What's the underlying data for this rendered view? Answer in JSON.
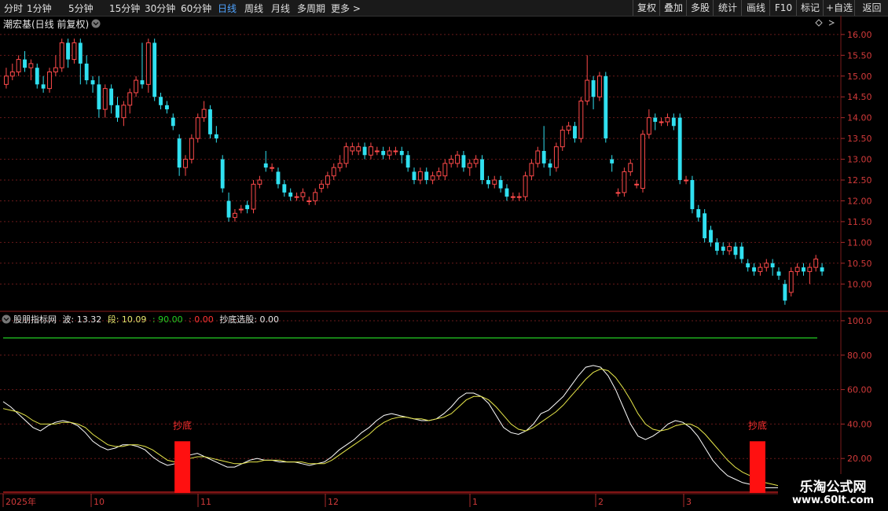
{
  "toolbar": {
    "periods": [
      "分时",
      "1分钟",
      "5分钟",
      "15分钟",
      "30分钟",
      "60分钟",
      "日线",
      "周线",
      "月线",
      "多周期",
      "更多"
    ],
    "active_period": "日线",
    "more_chevron": ">",
    "right_buttons": [
      "复权",
      "叠加",
      "多股",
      "统计",
      "画线",
      "F10",
      "标记",
      "+自选",
      "返回"
    ]
  },
  "main_panel": {
    "title": "潮宏基(日线 前复权)",
    "y_ticks": [
      "16.00",
      "15.50",
      "15.00",
      "14.50",
      "14.00",
      "13.50",
      "13.00",
      "12.50",
      "12.00",
      "11.50",
      "11.00",
      "10.50",
      "10.00"
    ]
  },
  "indicator_panel": {
    "name": "股朋指标网",
    "legend": [
      {
        "label": "波: 13.32",
        "color": "#e6e6e6"
      },
      {
        "label": "段: 10.09",
        "color": "#e6e66e"
      },
      {
        "label": ": 90.00",
        "color": "#22cc22"
      },
      {
        "label": ": 0.00",
        "color": "#ff3333"
      },
      {
        "label": "抄底选股: 0.00",
        "color": "#e6e6e6"
      }
    ],
    "y_ticks": [
      "100.0",
      "80.00",
      "60.00",
      "40.00",
      "20.00"
    ],
    "signal_label": "抄底"
  },
  "time_axis": [
    "2025年",
    "10",
    "11",
    "12",
    "1",
    "2",
    "3"
  ],
  "watermark": {
    "title": "乐淘公式网",
    "url": "www.60lt.com"
  },
  "colors": {
    "up": "#ff4a4a",
    "down": "#30e0f0",
    "wave": "#ffffff",
    "segment": "#e8e84a",
    "level_line": "#22cc22",
    "grid": "#6a1a1a",
    "signal": "#ff1010"
  },
  "chart_data": [
    {
      "type": "candlestick",
      "title": "潮宏基(日线 前复权)",
      "ylim": [
        9.4,
        16.3
      ],
      "candles": [
        [
          14.8,
          15.0,
          15.2,
          14.7
        ],
        [
          15.0,
          15.1,
          15.3,
          14.9
        ],
        [
          15.1,
          15.4,
          15.5,
          15.0
        ],
        [
          15.4,
          15.2,
          15.6,
          15.1
        ],
        [
          15.2,
          15.3,
          15.4,
          14.9
        ],
        [
          15.2,
          14.8,
          15.3,
          14.7
        ],
        [
          14.8,
          14.7,
          15.0,
          14.6
        ],
        [
          14.7,
          15.1,
          15.2,
          14.6
        ],
        [
          15.1,
          15.2,
          15.5,
          15.0
        ],
        [
          15.2,
          15.8,
          15.9,
          15.1
        ],
        [
          15.8,
          15.4,
          15.9,
          15.2
        ],
        [
          15.4,
          15.8,
          15.9,
          15.3
        ],
        [
          15.8,
          15.3,
          15.9,
          14.8
        ],
        [
          15.3,
          14.9,
          15.5,
          14.8
        ],
        [
          14.9,
          14.8,
          15.0,
          14.6
        ],
        [
          14.8,
          14.2,
          15.0,
          14.0
        ],
        [
          14.2,
          14.7,
          14.8,
          14.0
        ],
        [
          14.7,
          14.3,
          14.8,
          14.1
        ],
        [
          14.3,
          14.0,
          14.5,
          13.9
        ],
        [
          14.0,
          14.3,
          14.4,
          13.8
        ],
        [
          14.3,
          14.6,
          14.7,
          14.1
        ],
        [
          14.6,
          14.9,
          15.0,
          14.5
        ],
        [
          14.9,
          14.8,
          15.8,
          14.7
        ],
        [
          14.8,
          15.8,
          15.9,
          14.6
        ],
        [
          15.8,
          14.5,
          15.9,
          14.4
        ],
        [
          14.5,
          14.3,
          14.6,
          14.2
        ],
        [
          14.3,
          14.2,
          14.4,
          14.1
        ],
        [
          14.0,
          13.8,
          14.1,
          13.7
        ],
        [
          13.5,
          12.8,
          13.6,
          12.6
        ],
        [
          12.8,
          13.0,
          13.1,
          12.6
        ],
        [
          13.0,
          13.5,
          13.6,
          12.9
        ],
        [
          13.5,
          14.0,
          14.1,
          13.4
        ],
        [
          14.0,
          14.2,
          14.4,
          13.9
        ],
        [
          14.2,
          13.6,
          14.3,
          13.5
        ],
        [
          13.6,
          13.5,
          13.8,
          13.4
        ],
        [
          13.0,
          12.3,
          13.1,
          12.2
        ],
        [
          12.0,
          11.6,
          12.2,
          11.5
        ],
        [
          11.6,
          11.7,
          11.8,
          11.5
        ],
        [
          11.8,
          11.8,
          11.9,
          11.7
        ],
        [
          11.9,
          11.8,
          12.0,
          11.7
        ],
        [
          11.8,
          12.4,
          12.5,
          11.7
        ],
        [
          12.4,
          12.5,
          12.6,
          12.3
        ],
        [
          12.9,
          12.8,
          13.2,
          12.7
        ],
        [
          12.8,
          12.8,
          12.9,
          12.7
        ],
        [
          12.7,
          12.4,
          12.8,
          12.3
        ],
        [
          12.4,
          12.2,
          12.5,
          12.1
        ],
        [
          12.2,
          12.1,
          12.3,
          12.0
        ],
        [
          12.1,
          12.1,
          12.2,
          12.0
        ],
        [
          12.1,
          12.2,
          12.3,
          12.0
        ],
        [
          12.0,
          12.0,
          12.1,
          11.9
        ],
        [
          12.0,
          12.2,
          12.3,
          11.9
        ],
        [
          12.3,
          12.4,
          12.5,
          12.2
        ],
        [
          12.4,
          12.6,
          12.7,
          12.3
        ],
        [
          12.6,
          12.8,
          12.9,
          12.5
        ],
        [
          12.8,
          12.9,
          13.1,
          12.7
        ],
        [
          12.9,
          13.3,
          13.4,
          12.8
        ],
        [
          13.2,
          13.3,
          13.4,
          13.1
        ],
        [
          13.2,
          13.3,
          13.4,
          13.1
        ],
        [
          13.3,
          13.1,
          13.4,
          13.0
        ],
        [
          13.1,
          13.3,
          13.4,
          13.0
        ],
        [
          13.2,
          13.2,
          13.3,
          13.1
        ],
        [
          13.2,
          13.1,
          13.3,
          13.0
        ],
        [
          13.1,
          13.2,
          13.3,
          13.0
        ],
        [
          13.2,
          13.2,
          13.3,
          13.1
        ],
        [
          13.2,
          13.1,
          13.3,
          12.9
        ],
        [
          13.1,
          12.8,
          13.2,
          12.7
        ],
        [
          12.7,
          12.5,
          12.8,
          12.4
        ],
        [
          12.5,
          12.7,
          12.8,
          12.4
        ],
        [
          12.7,
          12.5,
          12.8,
          12.4
        ],
        [
          12.5,
          12.6,
          12.7,
          12.4
        ],
        [
          12.6,
          12.7,
          12.8,
          12.5
        ],
        [
          12.6,
          12.9,
          13.0,
          12.5
        ],
        [
          12.9,
          13.0,
          13.1,
          12.8
        ],
        [
          12.9,
          13.1,
          13.2,
          12.8
        ],
        [
          13.1,
          12.8,
          13.2,
          12.7
        ],
        [
          12.8,
          12.9,
          13.0,
          12.6
        ],
        [
          12.9,
          13.0,
          13.1,
          12.8
        ],
        [
          13.0,
          12.5,
          13.1,
          12.4
        ],
        [
          12.5,
          12.4,
          12.6,
          12.3
        ],
        [
          12.4,
          12.5,
          12.6,
          12.3
        ],
        [
          12.5,
          12.3,
          12.6,
          12.2
        ],
        [
          12.3,
          12.1,
          12.4,
          12.0
        ],
        [
          12.1,
          12.1,
          12.2,
          12.0
        ],
        [
          12.1,
          12.1,
          12.2,
          12.0
        ],
        [
          12.1,
          12.6,
          12.7,
          12.0
        ],
        [
          12.6,
          12.9,
          13.0,
          12.5
        ],
        [
          12.9,
          13.2,
          13.3,
          12.8
        ],
        [
          13.2,
          12.9,
          13.8,
          12.8
        ],
        [
          12.9,
          12.8,
          13.0,
          12.6
        ],
        [
          12.8,
          13.3,
          13.4,
          12.7
        ],
        [
          13.3,
          13.7,
          13.8,
          13.2
        ],
        [
          13.7,
          13.8,
          13.9,
          13.6
        ],
        [
          13.8,
          13.5,
          13.9,
          13.4
        ],
        [
          13.5,
          14.4,
          14.5,
          13.4
        ],
        [
          14.4,
          14.9,
          15.5,
          14.3
        ],
        [
          14.9,
          14.5,
          15.0,
          14.2
        ],
        [
          14.5,
          15.0,
          15.1,
          14.4
        ],
        [
          15.0,
          13.5,
          15.1,
          13.4
        ],
        [
          13.0,
          12.9,
          13.1,
          12.7
        ],
        [
          12.2,
          12.2,
          12.3,
          12.1
        ],
        [
          12.2,
          12.7,
          12.8,
          12.1
        ],
        [
          12.7,
          12.9,
          13.0,
          12.6
        ],
        [
          12.4,
          12.4,
          12.5,
          12.3
        ],
        [
          12.3,
          13.6,
          13.7,
          12.2
        ],
        [
          13.6,
          14.0,
          14.2,
          13.5
        ],
        [
          14.0,
          13.9,
          14.1,
          13.7
        ],
        [
          13.9,
          13.9,
          14.0,
          13.8
        ],
        [
          13.9,
          14.0,
          14.1,
          13.8
        ],
        [
          14.0,
          13.8,
          14.1,
          13.7
        ],
        [
          14.0,
          12.5,
          14.1,
          12.4
        ],
        [
          12.5,
          12.5,
          12.6,
          12.4
        ],
        [
          12.5,
          11.8,
          12.6,
          11.7
        ],
        [
          11.8,
          11.6,
          11.9,
          11.5
        ],
        [
          11.7,
          11.1,
          11.8,
          11.0
        ],
        [
          11.3,
          11.0,
          11.4,
          10.9
        ],
        [
          11.0,
          10.8,
          11.1,
          10.7
        ],
        [
          10.9,
          10.8,
          11.0,
          10.7
        ],
        [
          10.8,
          10.9,
          11.0,
          10.7
        ],
        [
          10.9,
          10.7,
          11.0,
          10.6
        ],
        [
          10.9,
          10.6,
          11.0,
          10.5
        ],
        [
          10.5,
          10.4,
          10.6,
          10.3
        ],
        [
          10.4,
          10.3,
          10.5,
          10.2
        ],
        [
          10.3,
          10.4,
          10.5,
          10.2
        ],
        [
          10.4,
          10.5,
          10.6,
          10.3
        ],
        [
          10.5,
          10.4,
          10.6,
          10.2
        ],
        [
          10.3,
          10.2,
          10.4,
          10.1
        ],
        [
          10.0,
          9.6,
          10.1,
          9.5
        ],
        [
          9.8,
          10.3,
          10.4,
          9.7
        ],
        [
          10.3,
          10.4,
          10.5,
          10.2
        ],
        [
          10.4,
          10.3,
          10.5,
          10.2
        ],
        [
          10.3,
          10.4,
          10.5,
          10.0
        ],
        [
          10.4,
          10.6,
          10.7,
          10.3
        ],
        [
          10.4,
          10.3,
          10.5,
          10.2
        ]
      ]
    },
    {
      "type": "line",
      "title": "股朋指标网",
      "ylim": [
        0,
        105
      ],
      "level": 90,
      "series": [
        {
          "name": "波",
          "values": [
            53,
            50,
            46,
            42,
            38,
            36,
            39,
            41,
            42,
            41,
            39,
            35,
            30,
            27,
            25,
            26,
            28,
            28,
            27,
            25,
            21,
            18,
            16,
            17,
            19,
            22,
            23,
            21,
            19,
            17,
            15,
            15,
            17,
            19,
            20,
            19,
            19,
            18,
            18,
            18,
            17,
            16,
            17,
            18,
            21,
            25,
            28,
            31,
            35,
            38,
            42,
            45,
            46,
            45,
            44,
            43,
            42,
            42,
            43,
            46,
            50,
            55,
            58,
            58,
            56,
            52,
            45,
            38,
            35,
            34,
            36,
            40,
            46,
            48,
            52,
            56,
            62,
            68,
            73,
            74,
            73,
            68,
            60,
            50,
            40,
            33,
            31,
            33,
            36,
            40,
            42,
            41,
            38,
            33,
            26,
            19,
            14,
            10,
            8,
            6,
            5,
            4,
            3,
            3,
            3,
            4,
            5,
            6,
            7,
            7
          ]
        },
        {
          "name": "段",
          "values": [
            49,
            48,
            47,
            45,
            42,
            40,
            40,
            40,
            41,
            41,
            40,
            38,
            34,
            31,
            28,
            27,
            27,
            28,
            28,
            27,
            25,
            22,
            19,
            18,
            18,
            20,
            21,
            21,
            20,
            19,
            18,
            17,
            17,
            18,
            18,
            19,
            19,
            19,
            18,
            18,
            18,
            17,
            17,
            17,
            19,
            22,
            25,
            28,
            31,
            34,
            38,
            41,
            43,
            44,
            44,
            43,
            43,
            42,
            43,
            44,
            46,
            50,
            54,
            56,
            56,
            54,
            50,
            45,
            40,
            37,
            36,
            38,
            41,
            44,
            47,
            51,
            56,
            61,
            66,
            70,
            72,
            71,
            67,
            61,
            54,
            46,
            40,
            37,
            36,
            37,
            39,
            40,
            40,
            38,
            34,
            29,
            24,
            19,
            15,
            12,
            10,
            8,
            6,
            5,
            4,
            4,
            4,
            5,
            6,
            6
          ]
        }
      ],
      "signals": [
        {
          "index": 24,
          "label": "抄底",
          "value": 30
        },
        {
          "index": 101,
          "label": "抄底",
          "value": 30
        }
      ]
    }
  ]
}
